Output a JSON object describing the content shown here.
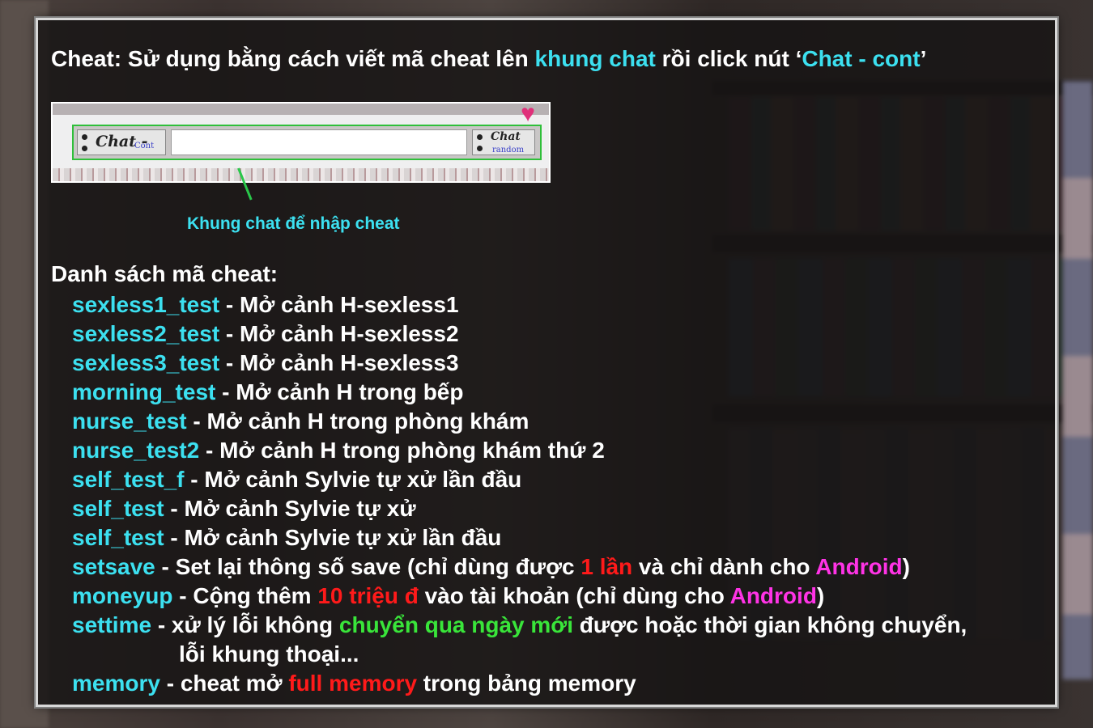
{
  "heading": {
    "prefix": "Cheat: Sử dụng bằng cách viết mã cheat lên ",
    "highlight1": "khung chat",
    "middle": " rồi click nút ‘",
    "highlight2": "Chat - cont",
    "suffix": "’"
  },
  "chat_image": {
    "left_button_main": "Chat - ",
    "left_button_sub": "Cont",
    "right_button_main": "Chat",
    "right_button_sub": "random",
    "heart_icon": "heart-icon"
  },
  "caption": "Khung chat để nhập cheat",
  "list_title": "Danh sách mã cheat:",
  "cheats": [
    {
      "code": "sexless1_test",
      "desc": " - Mở cảnh H-sexless1"
    },
    {
      "code": "sexless2_test",
      "desc": " - Mở cảnh H-sexless2"
    },
    {
      "code": "sexless3_test",
      "desc": " - Mở cảnh H-sexless3"
    },
    {
      "code": "morning_test",
      "desc": " - Mở cảnh H trong bếp"
    },
    {
      "code": "nurse_test",
      "desc": " - Mở cảnh H trong phòng khám"
    },
    {
      "code": "nurse_test2",
      "desc": " - Mở cảnh H trong phòng khám thứ 2"
    },
    {
      "code": "self_test_f",
      "desc": " - Mở cảnh Sylvie tự xử lần đầu"
    },
    {
      "code": "self_test",
      "desc": " - Mở cảnh Sylvie tự xử"
    },
    {
      "code": "self_test",
      "desc": " - Mở cảnh Sylvie tự xử lần đầu"
    }
  ],
  "setsave": {
    "code": "setsave",
    "part1": " - Set lại thông số save (chỉ dùng được ",
    "red": "1 lần",
    "part2": " và chỉ dành cho ",
    "magenta": "Android",
    "part3": ")"
  },
  "moneyup": {
    "code": "moneyup",
    "part1": " - Cộng thêm ",
    "red": "10 triệu đ",
    "part2": " vào tài khoản (chỉ dùng cho ",
    "magenta": "Android",
    "part3": ")"
  },
  "settime": {
    "code": "settime",
    "part1": " - xử lý lỗi không ",
    "green": "chuyển qua ngày mới",
    "part2": " được hoặc thời gian không chuyển,",
    "line2": "lỗi khung thoại..."
  },
  "memory": {
    "code": "memory",
    "part1": " - cheat mở ",
    "red": "full memory",
    "part2": " trong bảng memory"
  },
  "colors": {
    "cyan": "#3ce0f0",
    "red": "#ff1a1a",
    "magenta": "#ff33e6",
    "green": "#39e53a",
    "panel_border": "#d8d8d8"
  }
}
